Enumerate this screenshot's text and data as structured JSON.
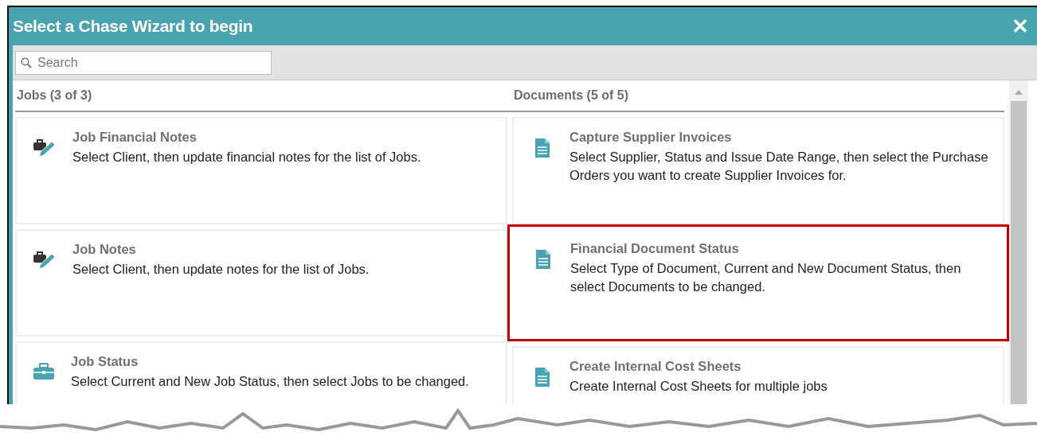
{
  "window": {
    "title": "Select a Chase Wizard to begin",
    "close": "✕"
  },
  "search": {
    "placeholder": "Search"
  },
  "columns": [
    {
      "heading": "Jobs (3 of 3)",
      "cards": [
        {
          "kind": "notes",
          "title": "Job Financial Notes",
          "description": "Select Client, then update financial notes for the list of Jobs.",
          "highlighted": false
        },
        {
          "kind": "notes",
          "title": "Job Notes",
          "description": "Select Client, then update notes for the list of Jobs.",
          "highlighted": false
        },
        {
          "kind": "briefcase",
          "title": "Job Status",
          "description": "Select Current and New Job Status, then select Jobs to be changed.",
          "highlighted": false
        }
      ]
    },
    {
      "heading": "Documents (5 of 5)",
      "cards": [
        {
          "kind": "document",
          "title": "Capture Supplier Invoices",
          "description": "Select Supplier, Status and Issue Date Range, then select the Purchase Orders you want to create Supplier Invoices for.",
          "highlighted": false
        },
        {
          "kind": "document",
          "title": "Financial Document Status",
          "description": "Select Type of Document, Current and New Document Status, then select Documents to be changed.",
          "highlighted": true
        },
        {
          "kind": "document",
          "title": "Create Internal Cost Sheets",
          "description": "Create Internal Cost Sheets for multiple jobs",
          "highlighted": false
        }
      ]
    }
  ]
}
